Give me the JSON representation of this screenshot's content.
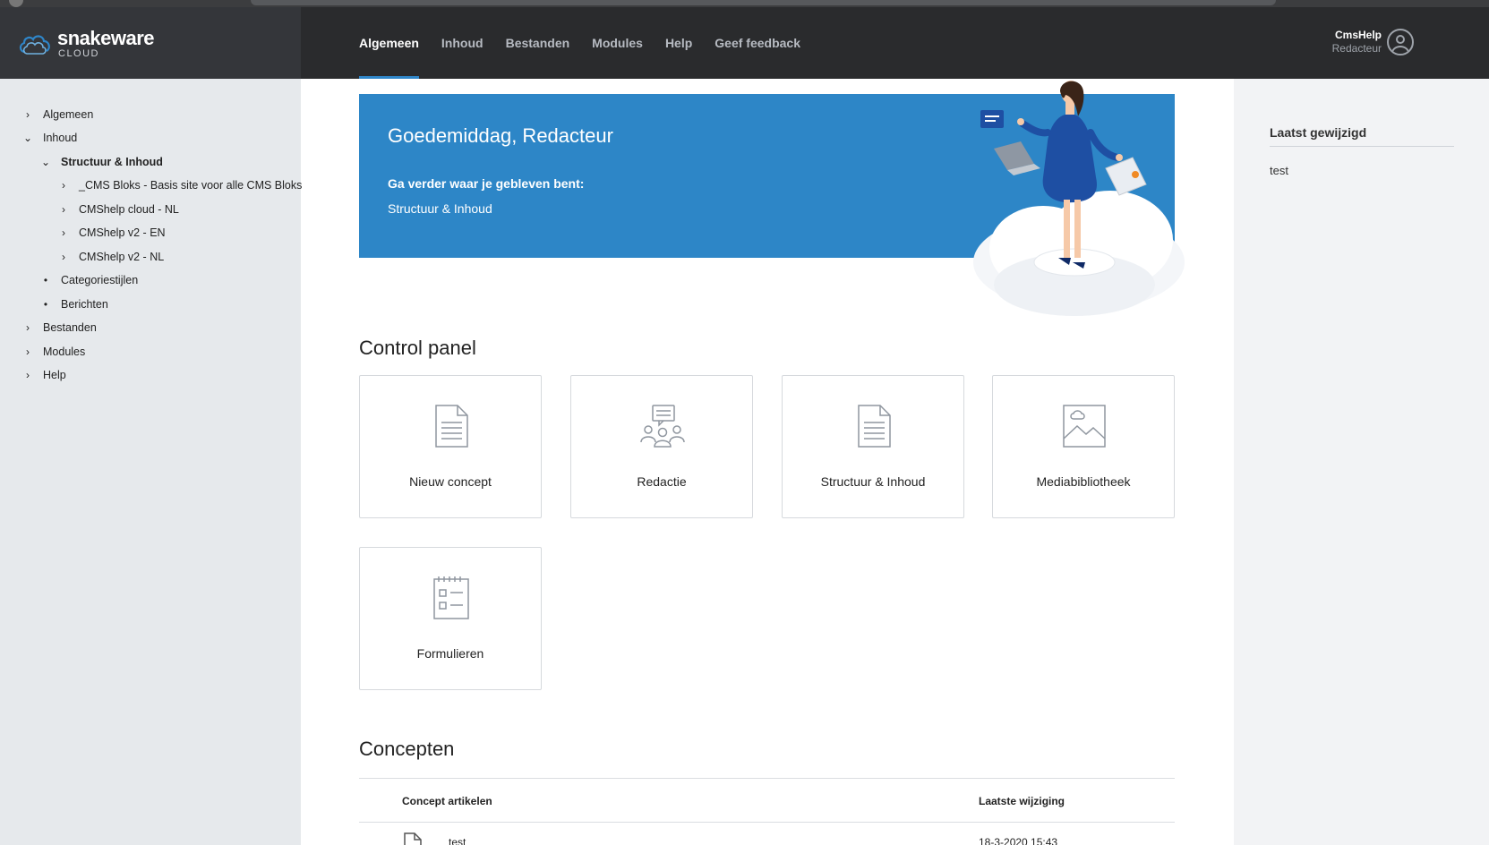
{
  "brand": {
    "name": "snakeware",
    "subtitle": "CLOUD"
  },
  "topnav": [
    {
      "label": "Algemeen",
      "active": true
    },
    {
      "label": "Inhoud",
      "active": false
    },
    {
      "label": "Bestanden",
      "active": false
    },
    {
      "label": "Modules",
      "active": false
    },
    {
      "label": "Help",
      "active": false
    },
    {
      "label": "Geef feedback",
      "active": false
    }
  ],
  "user": {
    "name": "CmsHelp",
    "role": "Redacteur"
  },
  "sidebar": {
    "items": [
      {
        "label": "Algemeen",
        "marker": "›"
      },
      {
        "label": "Inhoud",
        "marker": "⌄"
      },
      {
        "label": "Structuur & Inhoud",
        "marker": "⌄"
      },
      {
        "label": "_CMS Bloks - Basis site voor alle CMS Bloks",
        "marker": "›"
      },
      {
        "label": "CMShelp cloud - NL",
        "marker": "›"
      },
      {
        "label": "CMShelp v2 - EN",
        "marker": "›"
      },
      {
        "label": "CMShelp v2 - NL",
        "marker": "›"
      },
      {
        "label": "Categoriestijlen",
        "marker": "•"
      },
      {
        "label": "Berichten",
        "marker": "•"
      },
      {
        "label": "Bestanden",
        "marker": "›"
      },
      {
        "label": "Modules",
        "marker": "›"
      },
      {
        "label": "Help",
        "marker": "›"
      }
    ]
  },
  "hero": {
    "greeting": "Goedemiddag, Redacteur",
    "resume_text": "Ga verder waar je gebleven bent:",
    "resume_link": "Structuur & Inhoud"
  },
  "control_panel": {
    "title": "Control panel",
    "tiles": [
      {
        "label": "Nieuw concept",
        "icon": "document-icon"
      },
      {
        "label": "Redactie",
        "icon": "team-icon"
      },
      {
        "label": "Structuur & Inhoud",
        "icon": "document-icon"
      },
      {
        "label": "Mediabibliotheek",
        "icon": "image-icon"
      },
      {
        "label": "Formulieren",
        "icon": "form-icon"
      }
    ]
  },
  "concepts": {
    "title": "Concepten",
    "columns": [
      "Concept artikelen",
      "Laatste wijziging"
    ],
    "rows": [
      {
        "title": "test",
        "modified": "18-3-2020 15:43"
      }
    ]
  },
  "recent": {
    "title": "Laatst gewijzigd",
    "items": [
      "test"
    ]
  },
  "colors": {
    "header_bg": "#2a2b2d",
    "brand_bg": "#34363a",
    "accent": "#2f86c9",
    "hero_bg": "#2d86c7",
    "sidebar_bg": "#e6e9ec"
  }
}
